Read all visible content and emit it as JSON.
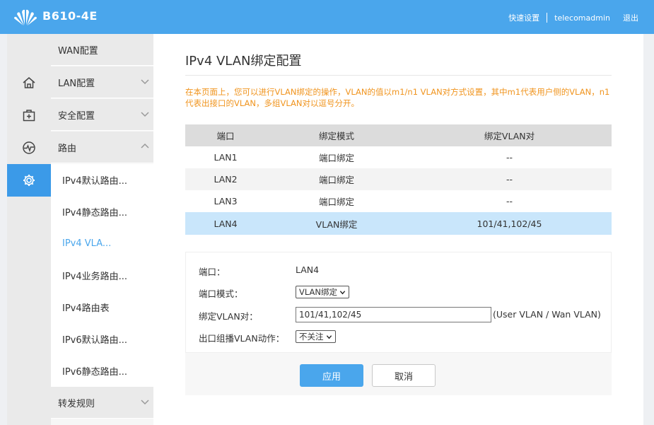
{
  "header": {
    "model": "B610-4E",
    "quick_setup": "快速设置",
    "user": "telecomadmin",
    "logout": "退出"
  },
  "rail": {
    "icons": [
      "home-icon",
      "first-aid-icon",
      "pulse-icon",
      "gear-icon"
    ],
    "active": 3
  },
  "menu": {
    "items": [
      {
        "label": "WAN配置"
      },
      {
        "label": "LAN配置"
      },
      {
        "label": "安全配置"
      },
      {
        "label": "路由"
      },
      {
        "label": "转发规则"
      }
    ],
    "route_sub": [
      "IPv4默认路由...",
      "IPv4静态路由...",
      "IPv4 VLA...",
      "IPv4业务路由...",
      "IPv4路由表",
      "IPv6默认路由...",
      "IPv6静态路由..."
    ],
    "active_sub": 2
  },
  "page": {
    "title": "IPv4 VLAN绑定配置",
    "notice": "在本页面上，您可以进行VLAN绑定的操作，VLAN的值以m1/n1 VLAN对方式设置，其中m1代表用户侧的VLAN，n1代表出接口的VLAN，多组VLAN对以逗号分开。"
  },
  "table": {
    "headers": [
      "端口",
      "绑定模式",
      "绑定VLAN对"
    ],
    "rows": [
      [
        "LAN1",
        "端口绑定",
        "--"
      ],
      [
        "LAN2",
        "端口绑定",
        "--"
      ],
      [
        "LAN3",
        "端口绑定",
        "--"
      ],
      [
        "LAN4",
        "VLAN绑定",
        "101/41,102/45"
      ]
    ],
    "selected_row": 3
  },
  "form": {
    "port_label": "端口：",
    "port_value": "LAN4",
    "mode_label": "端口模式：",
    "mode_value": "VLAN绑定",
    "vlan_label": "绑定VLAN对：",
    "vlan_value": "101/41,102/45",
    "vlan_hint": "(User VLAN / Wan VLAN)",
    "mcast_label": "出口组播VLAN动作：",
    "mcast_value": "不关注",
    "apply": "应用",
    "cancel": "取消"
  },
  "colors": {
    "header": "#4aa6ec",
    "notice": "#f0941e",
    "selected_row": "#c9e6fb",
    "active_menu": "#4aa6ec"
  }
}
